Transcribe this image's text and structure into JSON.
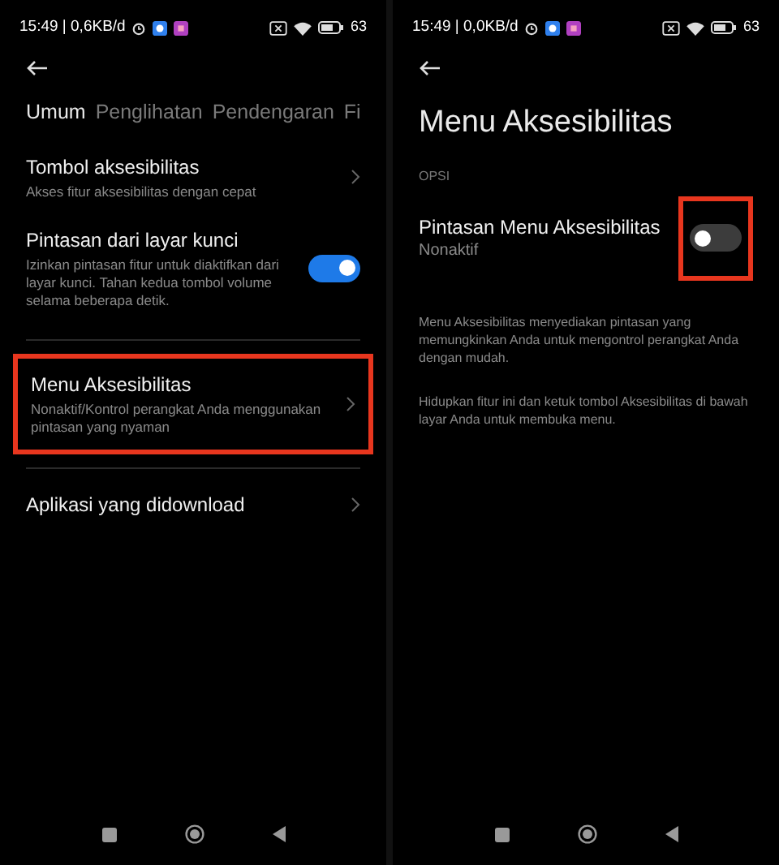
{
  "screens": [
    {
      "status_bar": {
        "time": "15:49 | 0,6KB/d",
        "battery": "63"
      },
      "tabs": [
        {
          "label": "Umum",
          "selected": true
        },
        {
          "label": "Penglihatan",
          "selected": false
        },
        {
          "label": "Pendengaran",
          "selected": false
        },
        {
          "label": "Fi",
          "selected": false
        }
      ],
      "items": [
        {
          "kind": "link",
          "title": "Tombol aksesibilitas",
          "subtitle": "Akses fitur aksesibilitas dengan cepat",
          "highlighted": false
        },
        {
          "kind": "toggle",
          "title": "Pintasan dari layar kunci",
          "subtitle": "Izinkan pintasan fitur untuk diaktifkan dari layar kunci. Tahan kedua tombol volume selama beberapa detik.",
          "on": true,
          "highlighted": false
        },
        {
          "kind": "divider"
        },
        {
          "kind": "link",
          "title": "Menu Aksesibilitas",
          "subtitle": "Nonaktif/Kontrol perangkat Anda menggunakan pintasan yang nyaman",
          "highlighted": true
        },
        {
          "kind": "divider"
        },
        {
          "kind": "link",
          "title": "Aplikasi yang didownload",
          "highlighted": false
        }
      ]
    },
    {
      "status_bar": {
        "time": "15:49 | 0,0KB/d",
        "battery": "63"
      },
      "title": "Menu Aksesibilitas",
      "section": "OPSI",
      "items": [
        {
          "kind": "toggle",
          "title": "Pintasan Menu Aksesibilitas",
          "subtitle": "Nonaktif",
          "on": false,
          "highlighted": true
        },
        {
          "kind": "note",
          "text": "Menu Aksesibilitas menyediakan pintasan yang memungkinkan Anda untuk mengontrol perangkat Anda dengan mudah."
        },
        {
          "kind": "note",
          "text": "Hidupkan fitur ini dan ketuk tombol Aksesibilitas di bawah layar Anda untuk membuka menu."
        }
      ]
    }
  ]
}
